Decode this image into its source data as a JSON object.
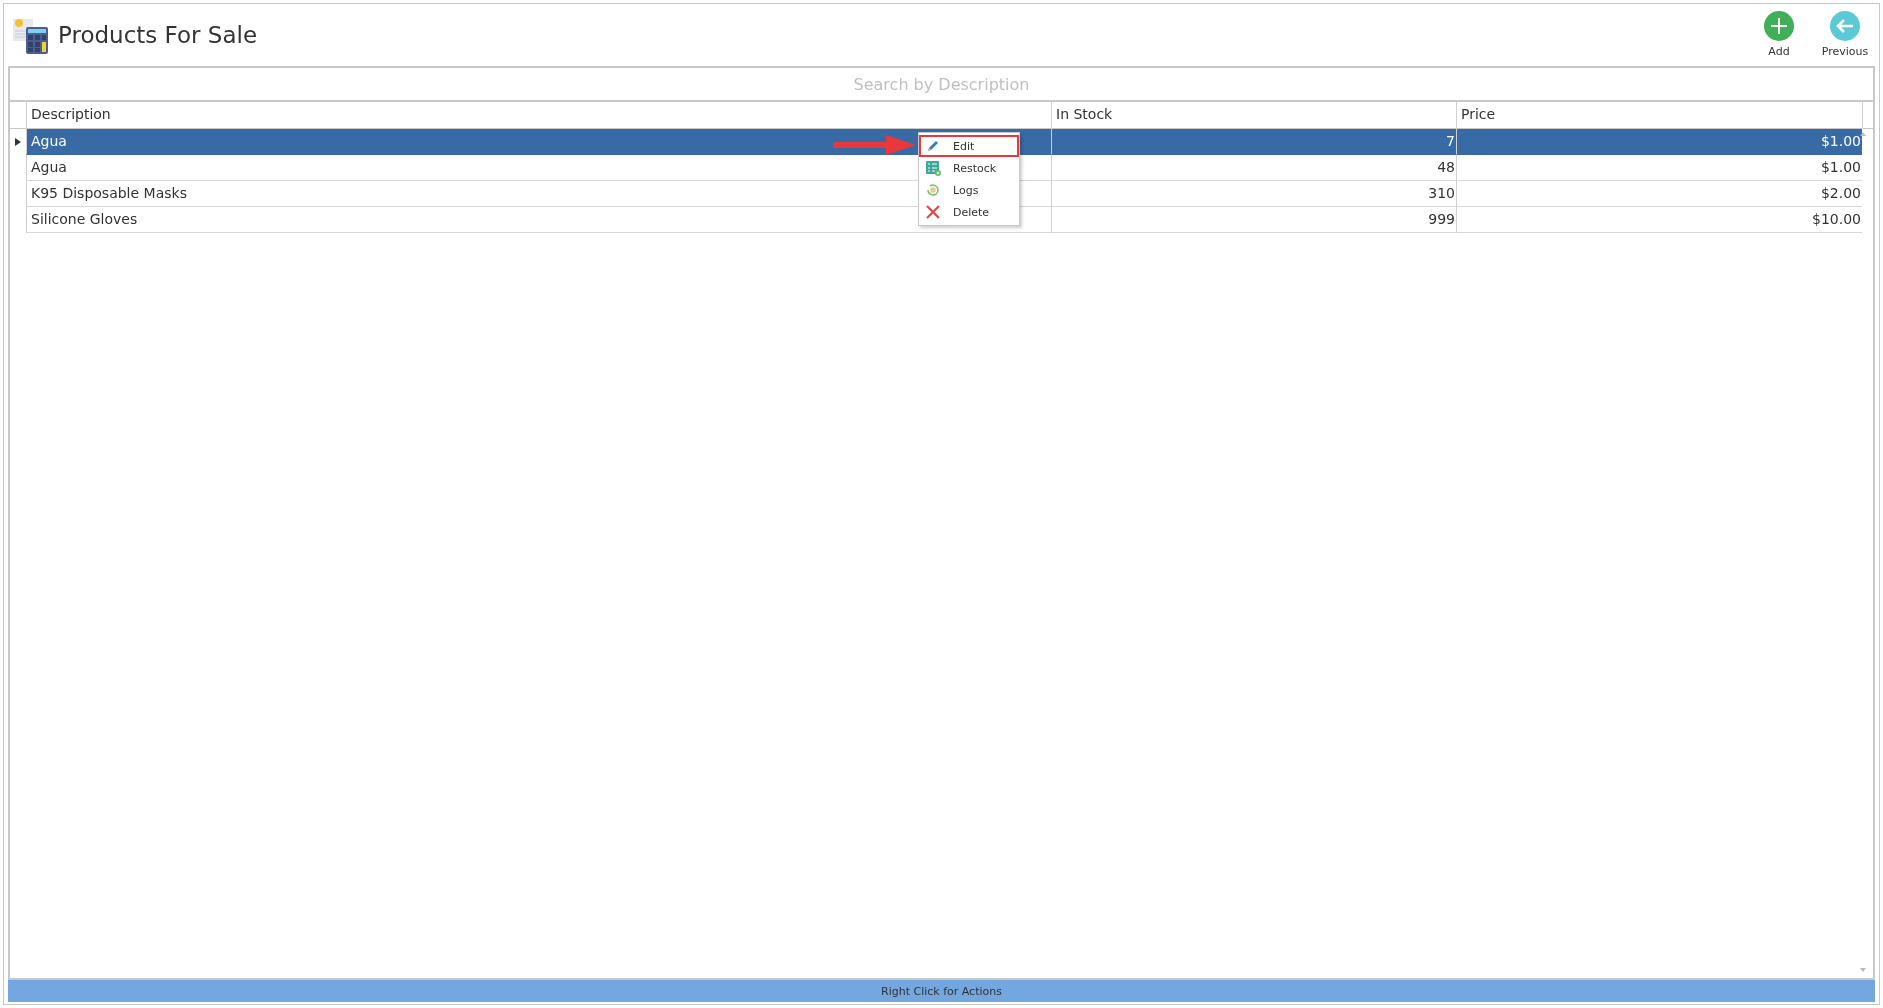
{
  "window": {
    "title": "Products For Sale"
  },
  "toolbar": [
    {
      "kind": "add",
      "label": "Add"
    },
    {
      "kind": "back",
      "label": "Previous"
    }
  ],
  "search": {
    "placeholder": "Search by Description"
  },
  "table": {
    "columns": [
      "Description",
      "In Stock",
      "Price"
    ],
    "rows": [
      {
        "cells": [
          "Agua",
          "7",
          "$1.00"
        ],
        "selected": true
      },
      {
        "cells": [
          "Agua",
          "48",
          "$1.00"
        ],
        "selected": false
      },
      {
        "cells": [
          "K95 Disposable Masks",
          "310",
          "$2.00"
        ],
        "selected": false
      },
      {
        "cells": [
          "Silicone Gloves",
          "999",
          "$10.00"
        ],
        "selected": false
      }
    ]
  },
  "context_menu": {
    "items": [
      {
        "kind": "edit",
        "label": "Edit",
        "highlighted": true
      },
      {
        "kind": "restock",
        "label": "Restock",
        "highlighted": false
      },
      {
        "kind": "logs",
        "label": "Logs",
        "highlighted": false
      },
      {
        "kind": "delete",
        "label": "Delete",
        "highlighted": false
      }
    ]
  },
  "status_bar": {
    "text": "Right Click for Actions"
  }
}
